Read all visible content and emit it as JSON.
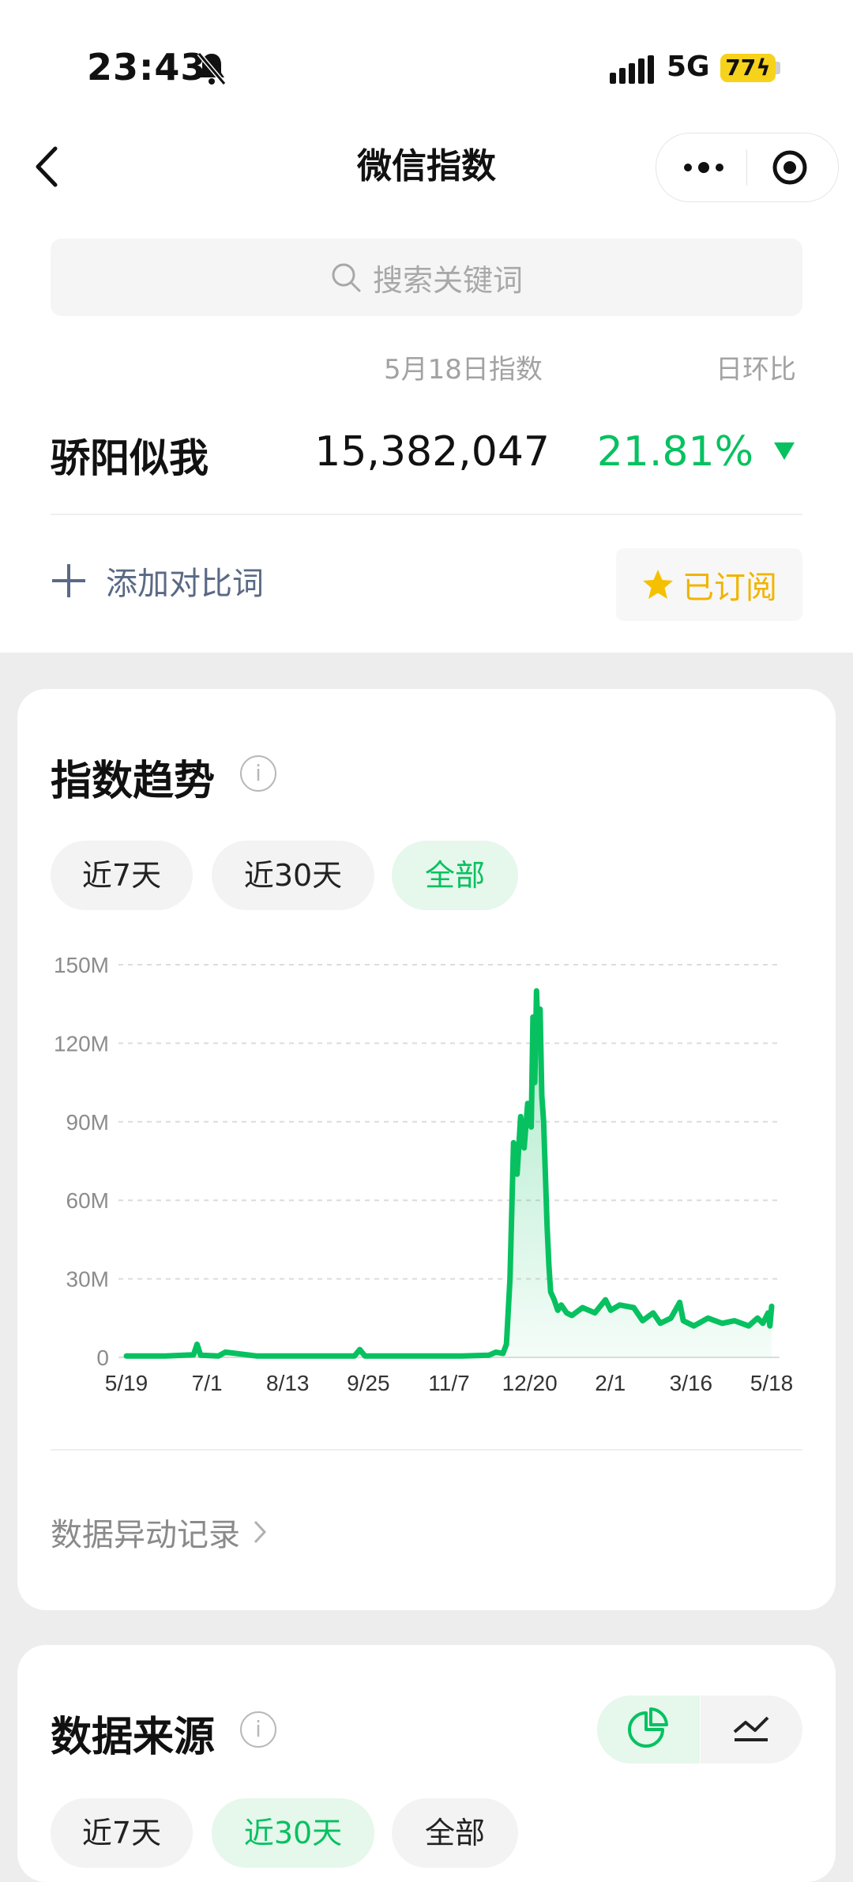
{
  "status_bar": {
    "time": "23:43",
    "network": "5G",
    "battery": "77"
  },
  "nav": {
    "title": "微信指数"
  },
  "search": {
    "placeholder": "搜索关键词"
  },
  "index_table": {
    "date_header": "5月18日指数",
    "change_header": "日环比",
    "keyword": "骄阳似我",
    "value": "15,382,047",
    "change": "21.81%",
    "change_color": "#07c160"
  },
  "actions": {
    "add_compare": "添加对比词",
    "subscribed": "已订阅"
  },
  "trend": {
    "title": "指数趋势",
    "info": "i",
    "ranges": [
      "近7天",
      "近30天",
      "全部"
    ],
    "selected": "全部"
  },
  "chart_data": {
    "type": "area",
    "x_ticks": [
      "5/19",
      "7/1",
      "8/13",
      "9/25",
      "11/7",
      "12/20",
      "2/1",
      "3/16",
      "5/18"
    ],
    "y_ticks": [
      "0",
      "30M",
      "60M",
      "90M",
      "120M",
      "150M"
    ],
    "ylim": [
      0,
      150000000
    ],
    "grid": true,
    "line_color": "#07c160",
    "x": [
      "2023-05-19",
      "2023-06-10",
      "2023-06-26",
      "2023-06-28",
      "2023-06-30",
      "2023-07-10",
      "2023-07-14",
      "2023-08-01",
      "2023-09-01",
      "2023-09-25",
      "2023-09-28",
      "2023-10-01",
      "2023-10-20",
      "2023-11-07",
      "2023-11-25",
      "2023-12-10",
      "2023-12-14",
      "2023-12-18",
      "2023-12-20",
      "2023-12-22",
      "2023-12-24",
      "2023-12-26",
      "2023-12-28",
      "2023-12-30",
      "2024-01-01",
      "2024-01-03",
      "2024-01-04",
      "2024-01-05",
      "2024-01-06",
      "2024-01-07",
      "2024-01-08",
      "2024-01-09",
      "2024-01-10",
      "2024-01-11",
      "2024-01-12",
      "2024-01-13",
      "2024-01-14",
      "2024-01-16",
      "2024-01-18",
      "2024-01-20",
      "2024-01-23",
      "2024-01-26",
      "2024-02-01",
      "2024-02-08",
      "2024-02-14",
      "2024-02-17",
      "2024-02-22",
      "2024-03-01",
      "2024-03-06",
      "2024-03-12",
      "2024-03-16",
      "2024-03-22",
      "2024-03-27",
      "2024-03-29",
      "2024-04-04",
      "2024-04-12",
      "2024-04-20",
      "2024-04-27",
      "2024-05-05",
      "2024-05-10",
      "2024-05-13",
      "2024-05-16",
      "2024-05-17",
      "2024-05-18"
    ],
    "values": [
      0.5,
      0.5,
      1,
      5,
      0.8,
      0.5,
      2,
      0.5,
      0.5,
      0.5,
      3,
      0.5,
      0.5,
      0.5,
      0.5,
      0.8,
      2,
      1.5,
      5,
      30,
      82,
      70,
      92,
      80,
      97,
      88,
      130,
      105,
      140,
      120,
      133,
      100,
      90,
      70,
      50,
      35,
      25,
      22,
      18,
      20,
      17,
      16,
      19,
      17,
      22,
      18,
      20,
      19,
      14,
      17,
      13,
      15,
      21,
      14,
      12,
      15,
      13,
      14,
      12,
      15,
      13,
      17,
      12,
      19.5
    ]
  },
  "sources": {
    "title": "数据来源",
    "info": "i",
    "ranges": [
      "近7天",
      "近30天",
      "全部"
    ],
    "selected": "近30天"
  },
  "anomaly": {
    "label": "数据异动记录"
  }
}
